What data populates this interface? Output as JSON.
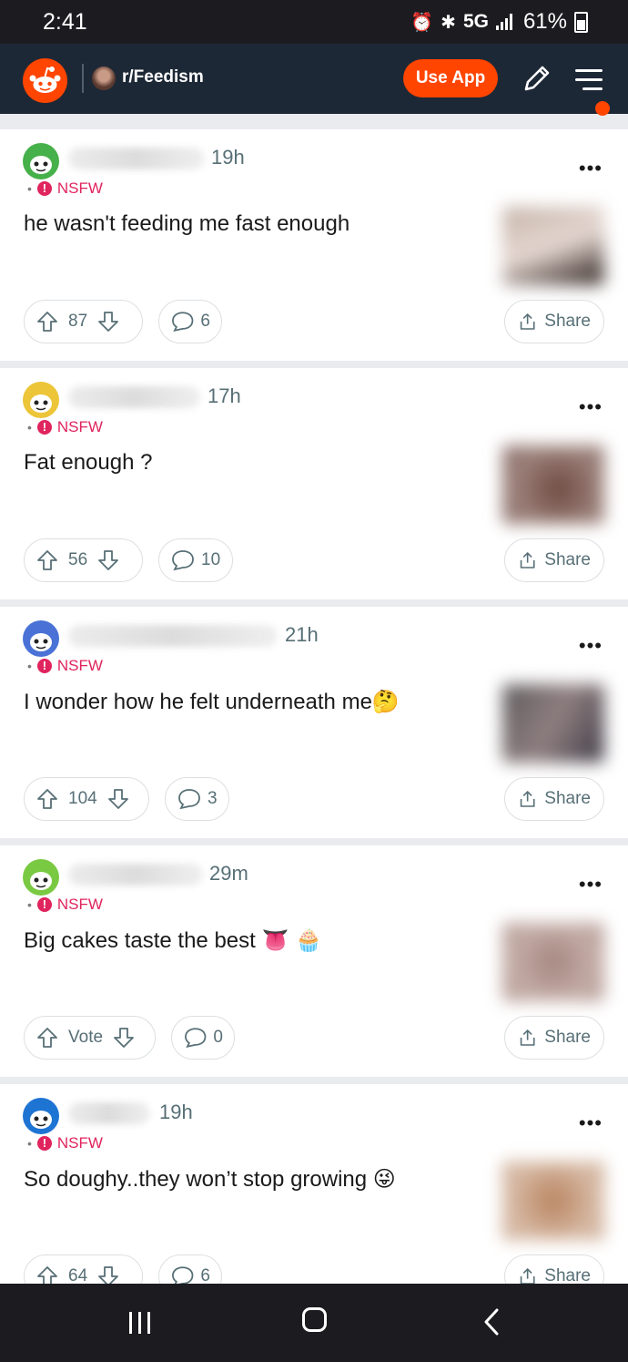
{
  "status_bar": {
    "time": "2:41",
    "network": "5G",
    "battery": "61%"
  },
  "header": {
    "subreddit": "r/Feedism",
    "use_app_label": "Use App"
  },
  "posts": [
    {
      "time": "19h",
      "nsfw": "NSFW",
      "title": "he wasn't feeding me fast enough",
      "votes": "87",
      "comments": "6",
      "share": "Share",
      "avatar_color": "#46b04a"
    },
    {
      "time": "17h",
      "nsfw": "NSFW",
      "title": "Fat enough ?",
      "votes": "56",
      "comments": "10",
      "share": "Share",
      "avatar_color": "#ecc538"
    },
    {
      "time": "21h",
      "nsfw": "NSFW",
      "title": "I wonder how he felt underneath me🤔",
      "votes": "104",
      "comments": "3",
      "share": "Share",
      "avatar_color": "#4a72d6"
    },
    {
      "time": "29m",
      "nsfw": "NSFW",
      "title": "Big cakes taste the best 👅 🧁",
      "votes": "Vote",
      "comments": "0",
      "share": "Share",
      "avatar_color": "#7ac943"
    },
    {
      "time": "19h",
      "nsfw": "NSFW",
      "title": "So doughy..they won’t stop growing 😜",
      "votes": "64",
      "comments": "6",
      "share": "Share",
      "avatar_color": "#1e74d3"
    }
  ],
  "icons": [
    "alarm-icon",
    "bluetooth-icon",
    "signal-icon",
    "battery-icon",
    "reddit-logo-icon",
    "pencil-icon",
    "menu-icon",
    "more-icon",
    "upvote-icon",
    "downvote-icon",
    "comment-icon",
    "share-icon",
    "nsfw-icon",
    "nav-recent-icon",
    "nav-home-icon",
    "nav-back-icon"
  ],
  "colors": {
    "accent": "#ff4500",
    "header_bg": "#1d2836",
    "nsfw": "#e0245e"
  }
}
